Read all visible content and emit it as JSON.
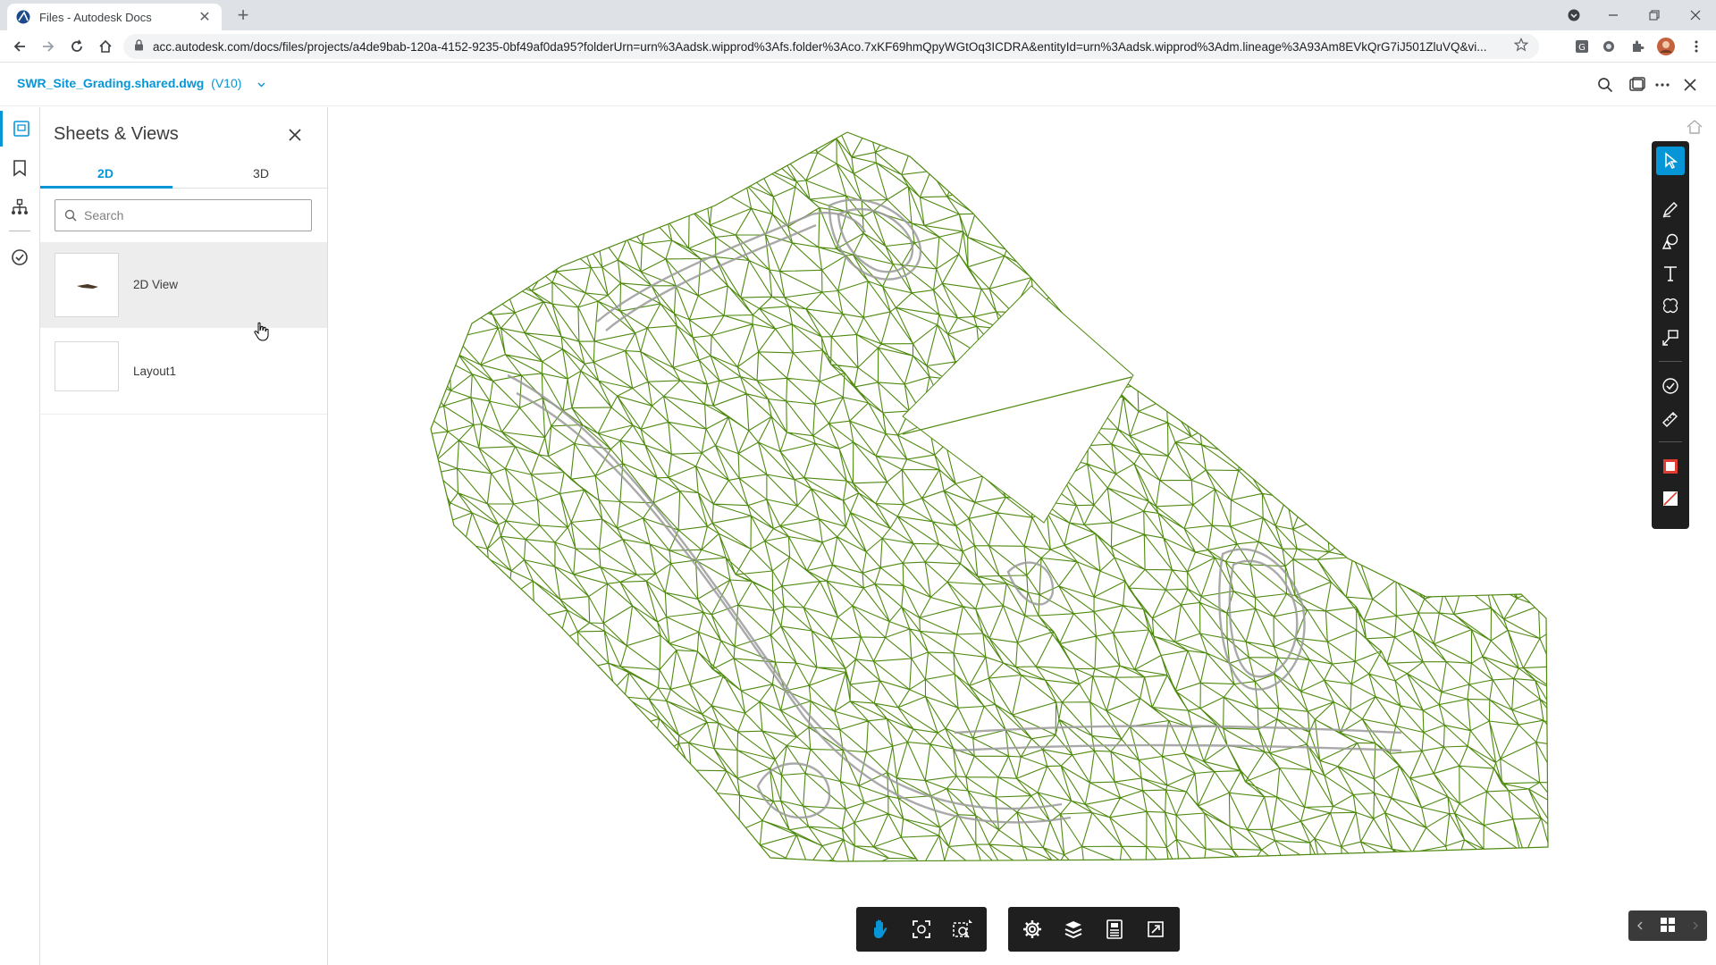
{
  "browser": {
    "tab_title": "Files - Autodesk Docs",
    "tab_close": "✕",
    "new_tab": "+",
    "url": "acc.autodesk.com/docs/files/projects/a4de9bab-120a-4152-9235-0bf49af0da95?folderUrn=urn%3Aadsk.wipprod%3Afs.folder%3Aco.7xKF69hmQpyWGtOq3ICDRA&entityId=urn%3Aadsk.wipprod%3Adm.lineage%3A93Am8EVkQrG7iJ501ZluVQ&vi..."
  },
  "header": {
    "file_name": "SWR_Site_Grading.shared.dwg",
    "version": "(V10)"
  },
  "panel": {
    "title": "Sheets & Views",
    "tabs": [
      {
        "label": "2D"
      },
      {
        "label": "3D"
      }
    ],
    "search_placeholder": "Search",
    "items": [
      {
        "label": "2D View"
      },
      {
        "label": "Layout1"
      }
    ]
  },
  "colors": {
    "accent": "#0696d7",
    "mesh": "#4f8a10",
    "toolbar_bg": "#1f1f1f",
    "markup_red": "#e03c31"
  },
  "icons": {
    "rail": [
      "sheets-icon",
      "bookmark-icon",
      "model-tree-icon",
      "issues-icon"
    ],
    "right_toolbar": [
      "select-icon",
      "freehand-icon",
      "shape-icon",
      "text-icon",
      "cloud-icon",
      "callout-icon",
      "stamp-icon",
      "measure-icon",
      "stroke-color-icon",
      "fill-color-icon"
    ],
    "bottom_toolbar": [
      "pan-icon",
      "fit-to-view-icon",
      "zoom-window-icon",
      "settings-icon",
      "layers-icon",
      "properties-icon",
      "fullscreen-icon"
    ]
  }
}
